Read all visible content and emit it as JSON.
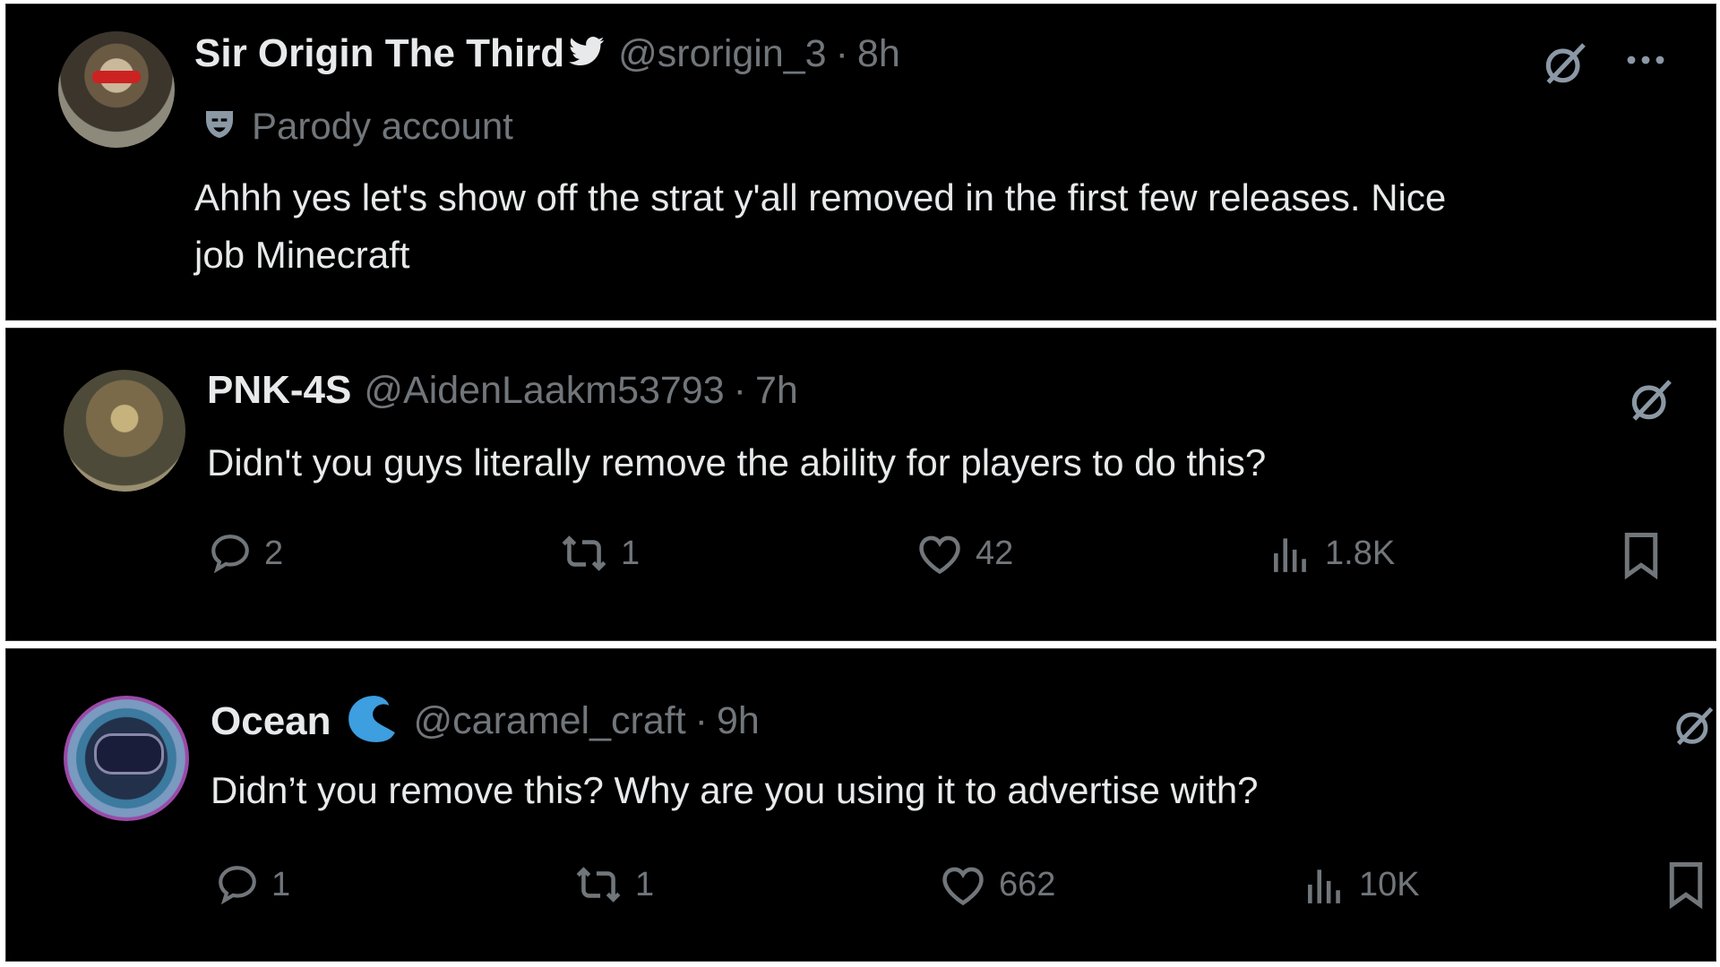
{
  "tweets": [
    {
      "name": "Sir Origin The Third",
      "handle": "@srorigin_3",
      "time": "8h",
      "sub_label": "Parody account",
      "text_line1": "Ahhh yes let's show off the strat y'all removed in the first few releases. Nice",
      "text_line2": "job Minecraft"
    },
    {
      "name": "PNK-4S",
      "handle": "@AidenLaakm53793",
      "time": "7h",
      "text": "Didn't you guys literally remove the ability for players to do this?",
      "replies": "2",
      "reposts": "1",
      "likes": "42",
      "views": "1.8K"
    },
    {
      "name": "Ocean",
      "handle": "@caramel_craft",
      "time": "9h",
      "text": "Didn’t you remove this? Why are you using it to advertise with?",
      "replies": "1",
      "reposts": "1",
      "likes": "662",
      "views": "10K"
    }
  ],
  "separator": "·",
  "colors": {
    "background": "#000000",
    "text": "#e7e9ea",
    "muted": "#71767b",
    "ocean_badge": "#3d9ee0"
  },
  "icons": [
    "bird-icon",
    "parody-mask-icon",
    "grok-icon",
    "more-icon",
    "reply-icon",
    "repost-icon",
    "like-icon",
    "views-icon",
    "bookmark-icon",
    "wave-badge-icon"
  ]
}
